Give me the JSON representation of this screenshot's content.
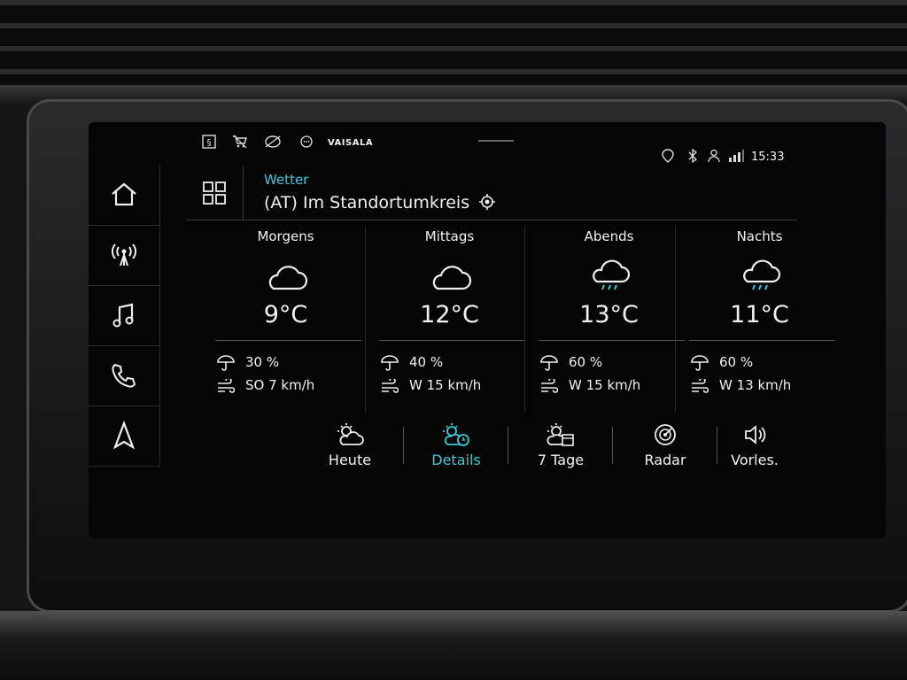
{
  "status_bar": {
    "brand": "VAISALA",
    "time": "15:33",
    "icons": [
      "notice-icon",
      "cart-icon",
      "no-signal-icon",
      "dots-icon",
      "location-pin-icon",
      "bluetooth-icon",
      "user-icon",
      "signal-bars-icon"
    ]
  },
  "sidebar": {
    "items": [
      {
        "name": "home-icon"
      },
      {
        "name": "radio-icon"
      },
      {
        "name": "media-icon"
      },
      {
        "name": "phone-icon"
      },
      {
        "name": "navigation-icon"
      }
    ]
  },
  "header": {
    "app_title": "Wetter",
    "location": "(AT) Im Standortumkreis"
  },
  "forecast": [
    {
      "period": "Morgens",
      "icon": "cloud-icon",
      "temp": "9°C",
      "rain": "30 %",
      "wind": "SO 7 km/h"
    },
    {
      "period": "Mittags",
      "icon": "cloud-icon",
      "temp": "12°C",
      "rain": "40 %",
      "wind": "W 15 km/h"
    },
    {
      "period": "Abends",
      "icon": "rain-cloud-icon",
      "temp": "13°C",
      "rain": "60 %",
      "wind": "W 15 km/h"
    },
    {
      "period": "Nachts",
      "icon": "rain-cloud-icon",
      "temp": "11°C",
      "rain": "60 %",
      "wind": "W 13 km/h"
    }
  ],
  "tabs": [
    {
      "label": "Heute",
      "icon": "sun-cloud-icon",
      "active": false
    },
    {
      "label": "Details",
      "icon": "sun-cloud-clock-icon",
      "active": true
    },
    {
      "label": "7 Tage",
      "icon": "sun-calendar-icon",
      "active": false
    },
    {
      "label": "Radar",
      "icon": "radar-icon",
      "active": false
    },
    {
      "label": "Vorles.",
      "icon": "speaker-icon",
      "active": false
    }
  ],
  "colors": {
    "accent": "#3ec9d8",
    "text": "#f2f2f2",
    "background": "#050506"
  }
}
